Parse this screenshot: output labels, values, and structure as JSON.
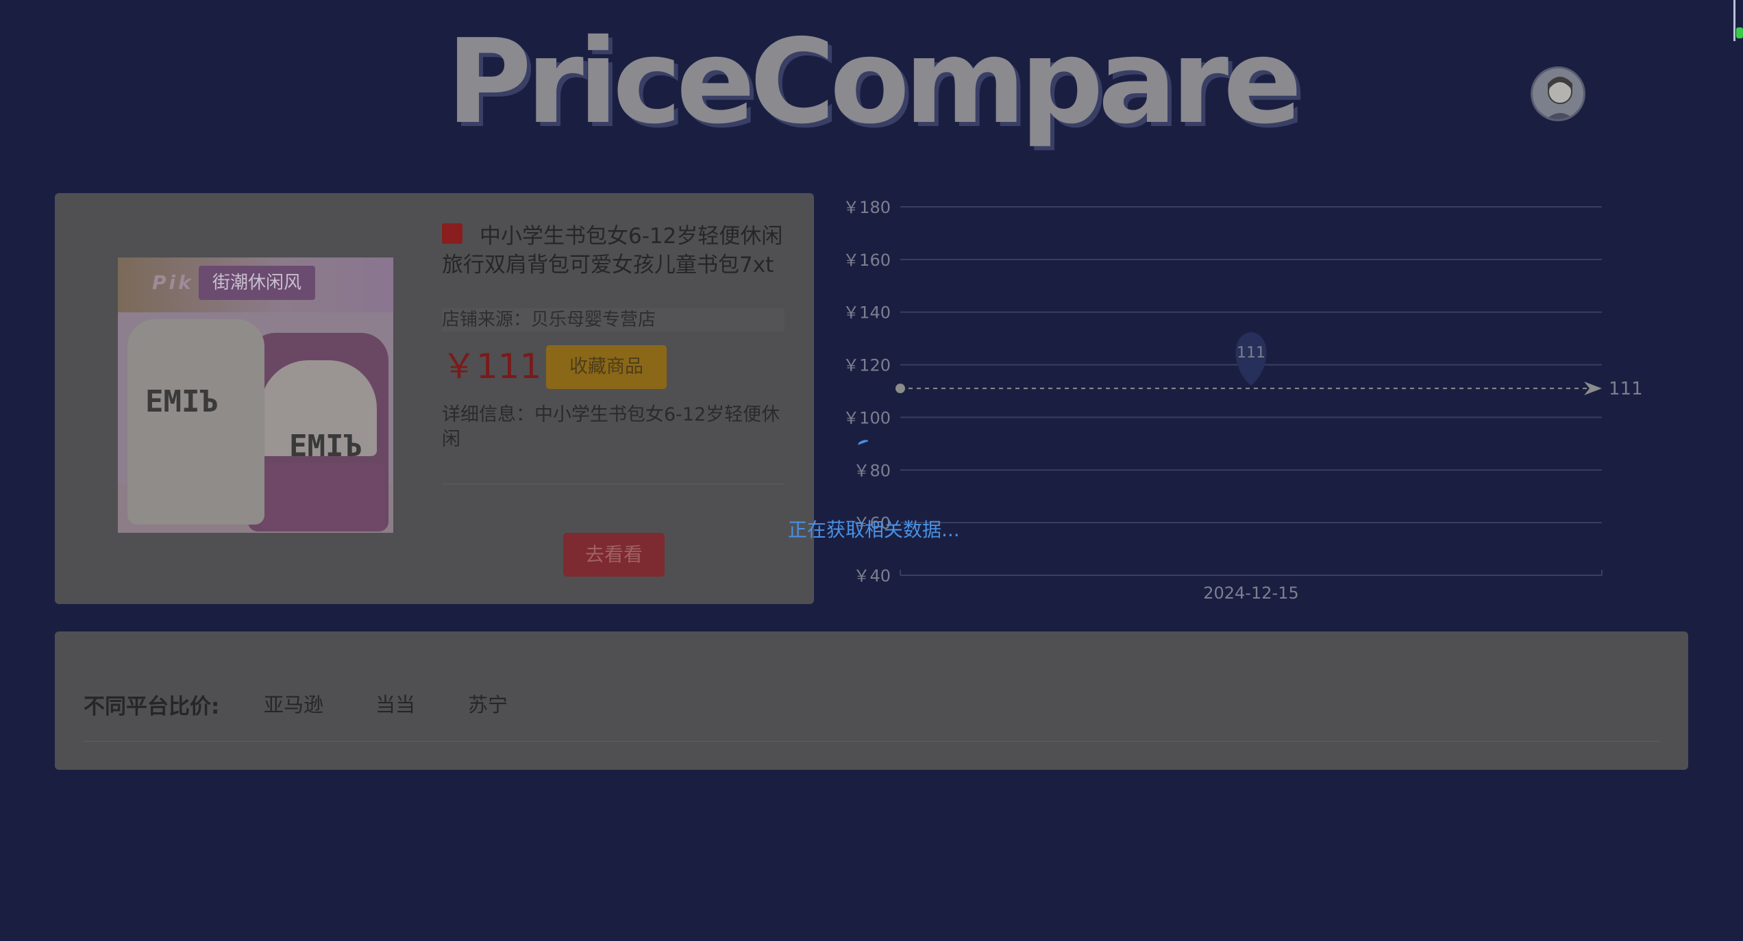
{
  "header": {
    "logo": "PriceCompare",
    "avatar_icon": "user-avatar-icon"
  },
  "product": {
    "image_badge": "街潮休闲风",
    "image_pack_text": "Pik          ack",
    "bag_letters": "EMIЪ",
    "platform_icon": "taobao-icon",
    "title": "中小学生书包女6-12岁轻便休闲旅行双肩背包可爱女孩儿童书包7xt",
    "shop_label": "店铺来源：贝乐母婴专营店",
    "price": "￥111",
    "collect_label": "收藏商品",
    "detail_label": "详细信息：中小学生书包女6-12岁轻便休闲",
    "go_label": "去看看"
  },
  "loading": {
    "text": "正在获取相关数据..."
  },
  "compare": {
    "label": "不同平台比价:",
    "platforms": [
      "亚马逊",
      "当当",
      "苏宁"
    ]
  },
  "chart_data": {
    "type": "line",
    "x": [
      "2024-12-15"
    ],
    "series": [
      {
        "values": [
          111
        ]
      }
    ],
    "y_ticks": [
      "￥180",
      "￥160",
      "￥140",
      "￥120",
      "￥100",
      "￥80",
      "￥60",
      "￥40"
    ],
    "ylim": [
      40,
      180
    ],
    "point_label": "111",
    "end_label": "111",
    "grid": true,
    "colors": {
      "line": "#8c8c8c",
      "grid": "#3a3f5e",
      "text": "#7d7f8e"
    }
  }
}
